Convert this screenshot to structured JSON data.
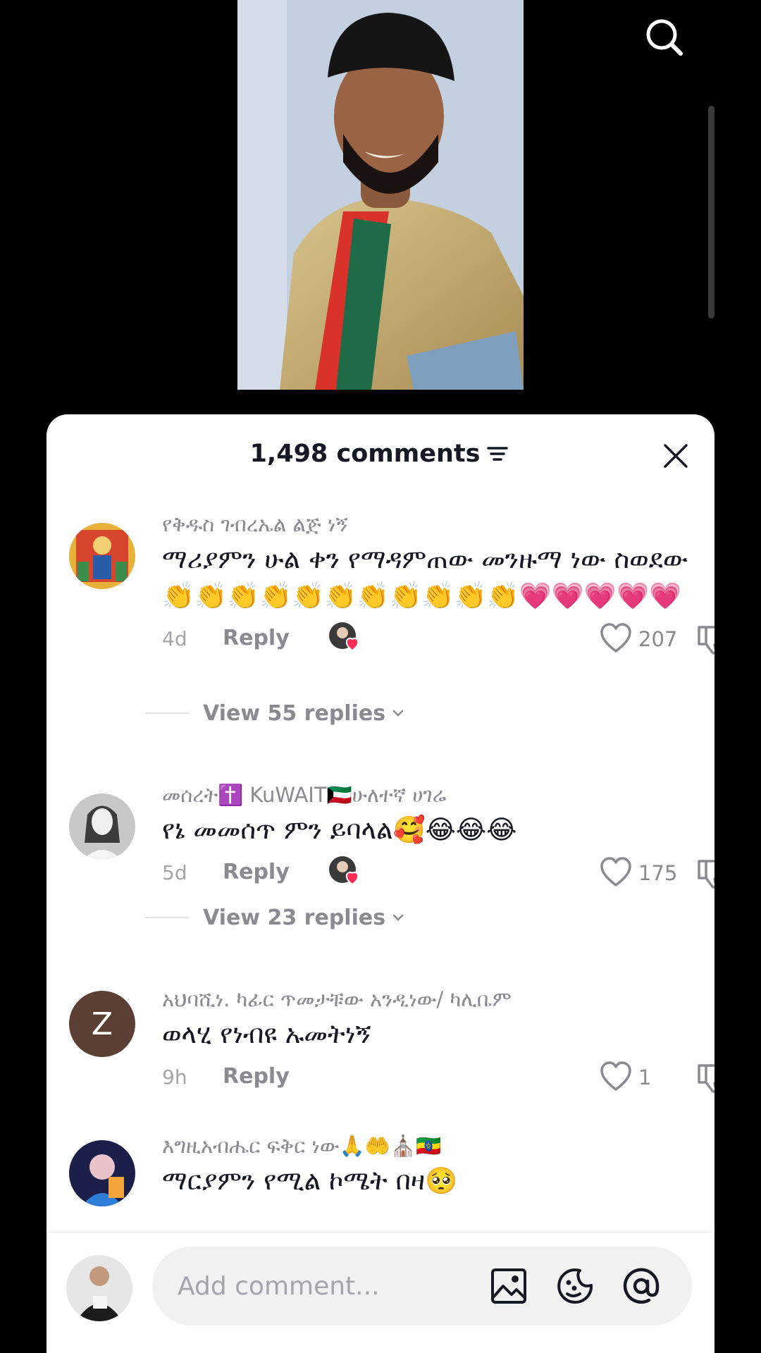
{
  "header": {
    "comment_count": "1,498 comments"
  },
  "icons": {
    "search": "search-icon",
    "sort": "sort-icon",
    "close": "close-icon",
    "like": "heart-outline-icon",
    "dislike": "thumbs-down-icon",
    "image": "image-icon",
    "emoji": "emoji-icon",
    "mention": "at-mention-icon"
  },
  "comments": [
    {
      "username": "የቅዱስ ገብረኤል ልጅ ነኝ",
      "text": "ማሪያምን ሁል ቀን የማዳምጠው መንዙማ ነው ስወደው👏👏👏👏👏👏👏👏👏👏👏💗💗💗💗💗",
      "time": "4d",
      "reply_label": "Reply",
      "likes": "207",
      "creator_liked": true,
      "view_replies": "View 55 replies"
    },
    {
      "username": "መሰረት✝️ KuWAIT🇰🇼ሁለተኛ ሀገሬ",
      "text": "የኔ መመሰጥ ምን ይባላል🥰😂😂😂",
      "time": "5d",
      "reply_label": "Reply",
      "likes": "175",
      "creator_liked": true,
      "view_replies": "View 23 replies"
    },
    {
      "username": "አህባሺነ. ካፊር ጥመታቹው አንዲነው/ ካሊቤም",
      "avatar_letter": "Z",
      "text": "ወላሂ የነብዩ ኡመትነኝ",
      "time": "9h",
      "reply_label": "Reply",
      "likes": "1",
      "creator_liked": false
    },
    {
      "username": "እግዚአብሔር ፍቅር ነው🙏🤲⛪🇪🇹",
      "text": "ማርያምን የሚል ኮሜት በዛ🥺"
    }
  ],
  "input": {
    "placeholder": "Add comment..."
  },
  "colors": {
    "sheet": "#ffffff",
    "text": "#161823",
    "secondary": "#8a8b91",
    "like_heart": "#fe2c55",
    "background": "#000000"
  }
}
